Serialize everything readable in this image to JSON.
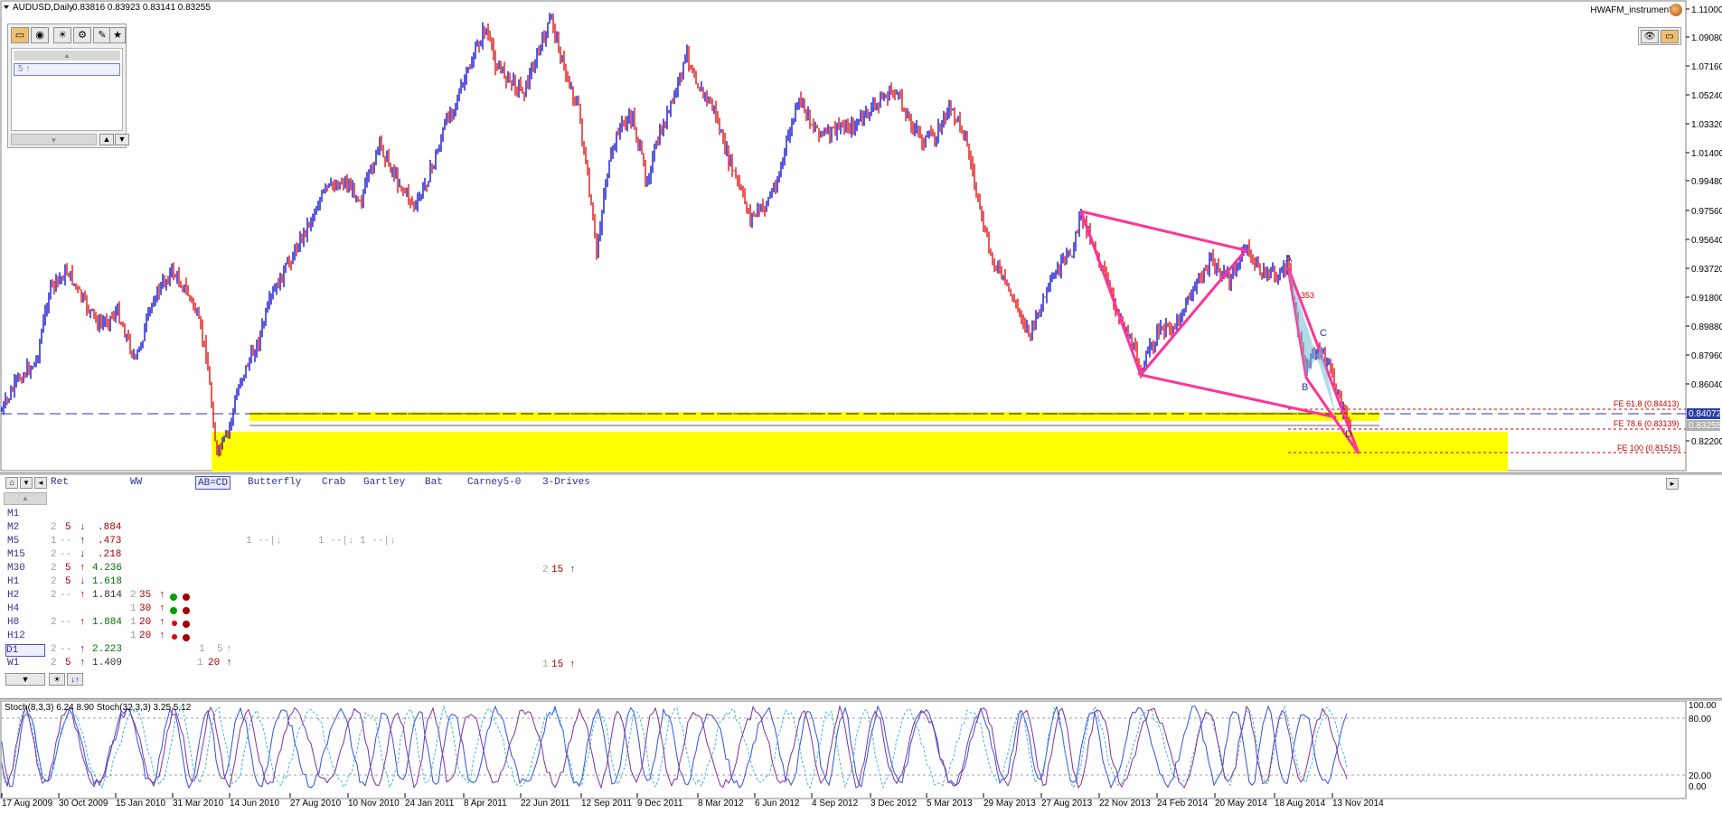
{
  "chart": {
    "title": "AUDUSD,Daily",
    "ohlc": "0.83816 0.83923 0.83141 0.83255",
    "indicator_name": "HWAFM_instrument",
    "current_price": "0.84072",
    "bid_price": "0.83255",
    "price_axis": [
      "1.11000",
      "1.09080",
      "1.07160",
      "1.05240",
      "1.03320",
      "1.01400",
      "0.99480",
      "0.97560",
      "0.95640",
      "0.93720",
      "0.91800",
      "0.89880",
      "0.87960",
      "0.86040",
      "0.82200"
    ],
    "fib_labels": [
      {
        "text": "FE 61.8 (0.84413)"
      },
      {
        "text": "FE 78.6 (0.83139)"
      },
      {
        "text": "FE 100 (0.81515)"
      }
    ],
    "pattern_points": [
      "A",
      "B",
      "C",
      "D"
    ],
    "inline_label": "353",
    "colors": {
      "bull": "#0000cc",
      "bear": "#e00000",
      "pattern": "#ff3399",
      "zone": "#ffff00",
      "fib": "#cc0000"
    }
  },
  "pattern_panel": {
    "list_item": "5  ↑"
  },
  "table": {
    "tabs": [
      "Ret",
      "WW",
      "AB=CD",
      "Butterfly",
      "Crab",
      "Gartley",
      "Bat",
      "Carney5-0",
      "3-Drives"
    ],
    "active_tab": "AB=CD",
    "timeframes": [
      "M1",
      "M2",
      "M5",
      "M15",
      "M30",
      "H1",
      "H2",
      "H4",
      "H8",
      "H12",
      "D1",
      "W1"
    ],
    "selected_timeframe": "D1",
    "rows": {
      "M2": {
        "count": "2",
        "level": "5",
        "dir": "↓",
        "value": ".884"
      },
      "M5": {
        "count": "1",
        "level": "--",
        "dir": "↑",
        "value": ".473"
      },
      "M15": {
        "count": "2",
        "level": "--",
        "dir": "↓",
        "value": ".218"
      },
      "M30": {
        "count": "2",
        "level": "5",
        "dir": "↑",
        "value": "4.236"
      },
      "H1": {
        "count": "2",
        "level": "5",
        "dir": "↓",
        "value": "1.618"
      },
      "H2": {
        "count": "2",
        "level": "--",
        "dir": "↑",
        "value": "1.814"
      },
      "H8": {
        "count": "2",
        "level": "--",
        "dir": "↑",
        "value": "1.884"
      },
      "D1": {
        "count": "2",
        "level": "--",
        "dir": "↑",
        "value": "2.223"
      },
      "W1": {
        "count": "2",
        "level": "5",
        "dir": "↑",
        "value": "1.409"
      }
    },
    "extra": {
      "m5_a": "1 --|↓",
      "m5_b": "1 --|↓",
      "m5_c": "1 --|↓",
      "h2_b": {
        "count": "2",
        "level": "35",
        "dir": "↑"
      },
      "h4_b": {
        "count": "1",
        "level": "30",
        "dir": "↑"
      },
      "h8_b": {
        "count": "1",
        "level": "20",
        "dir": "↑"
      },
      "h12_b": {
        "count": "1",
        "level": "20",
        "dir": "↑"
      },
      "d1_b": {
        "count": "1",
        "level": "5",
        "dir": "↑"
      },
      "w1_b": {
        "count": "1",
        "level": "20",
        "dir": "↑"
      },
      "m30_c": {
        "count": "2",
        "level": "15",
        "dir": "↑"
      },
      "w1_c": {
        "count": "1",
        "level": "15",
        "dir": "↑"
      }
    }
  },
  "stoch": {
    "label": "Stoch(8,3,3) 6.24 8.90 Stoch(32,3,3) 3.25 5.12",
    "axis": [
      "100.00",
      "80.00",
      "20.00",
      "0.00"
    ]
  },
  "dates": [
    "17 Aug 2009",
    "30 Oct 2009",
    "15 Jan 2010",
    "31 Mar 2010",
    "14 Jun 2010",
    "27 Aug 2010",
    "10 Nov 2010",
    "24 Jan 2011",
    "8 Apr 2011",
    "22 Jun 2011",
    "12 Sep 2011",
    "9 Dec 2011",
    "8 Mar 2012",
    "6 Jun 2012",
    "4 Sep 2012",
    "3 Dec 2012",
    "5 Mar 2013",
    "29 May 2013",
    "27 Aug 2013",
    "22 Nov 2013",
    "24 Feb 2014",
    "20 May 2014",
    "18 Aug 2014",
    "13 Nov 2014"
  ]
}
